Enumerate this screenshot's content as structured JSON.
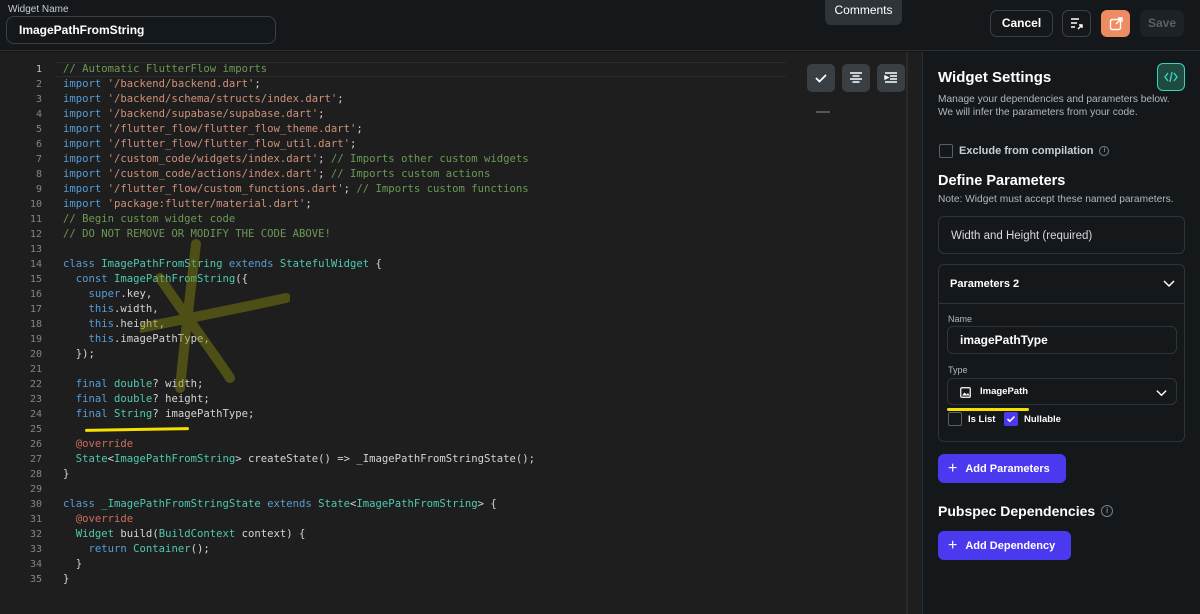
{
  "header": {
    "widget_name_label": "Widget Name",
    "widget_name_value": "ImagePathFromString",
    "comments_tooltip": "Comments",
    "cancel_label": "Cancel",
    "save_label": "Save",
    "accent_color": "#ee8b60"
  },
  "editor": {
    "active_line": 1,
    "line_numbers": [
      "1",
      "2",
      "3",
      "4",
      "5",
      "6",
      "7",
      "8",
      "9",
      "10",
      "11",
      "12",
      "13",
      "14",
      "15",
      "16",
      "17",
      "18",
      "19",
      "20",
      "21",
      "22",
      "23",
      "24",
      "25",
      "26",
      "27",
      "28",
      "29",
      "30",
      "31",
      "32",
      "33",
      "34",
      "35"
    ],
    "lines": [
      [
        [
          "c-cm",
          "// Automatic FlutterFlow imports"
        ]
      ],
      [
        [
          "c-kw",
          "import "
        ],
        [
          "c-st",
          "'/backend/backend.dart'"
        ],
        [
          "c-pu",
          ";"
        ]
      ],
      [
        [
          "c-kw",
          "import "
        ],
        [
          "c-st",
          "'/backend/schema/structs/index.dart'"
        ],
        [
          "c-pu",
          ";"
        ]
      ],
      [
        [
          "c-kw",
          "import "
        ],
        [
          "c-st",
          "'/backend/supabase/supabase.dart'"
        ],
        [
          "c-pu",
          ";"
        ]
      ],
      [
        [
          "c-kw",
          "import "
        ],
        [
          "c-st",
          "'/flutter_flow/flutter_flow_theme.dart'"
        ],
        [
          "c-pu",
          ";"
        ]
      ],
      [
        [
          "c-kw",
          "import "
        ],
        [
          "c-st",
          "'/flutter_flow/flutter_flow_util.dart'"
        ],
        [
          "c-pu",
          ";"
        ]
      ],
      [
        [
          "c-kw",
          "import "
        ],
        [
          "c-st",
          "'/custom_code/widgets/index.dart'"
        ],
        [
          "c-pu",
          "; "
        ],
        [
          "c-cm",
          "// Imports other custom widgets"
        ]
      ],
      [
        [
          "c-kw",
          "import "
        ],
        [
          "c-st",
          "'/custom_code/actions/index.dart'"
        ],
        [
          "c-pu",
          "; "
        ],
        [
          "c-cm",
          "// Imports custom actions"
        ]
      ],
      [
        [
          "c-kw",
          "import "
        ],
        [
          "c-st",
          "'/flutter_flow/custom_functions.dart'"
        ],
        [
          "c-pu",
          "; "
        ],
        [
          "c-cm",
          "// Imports custom functions"
        ]
      ],
      [
        [
          "c-kw",
          "import "
        ],
        [
          "c-st",
          "'package:flutter/material.dart'"
        ],
        [
          "c-pu",
          ";"
        ]
      ],
      [
        [
          "c-cm",
          "// Begin custom widget code"
        ]
      ],
      [
        [
          "c-cm",
          "// DO NOT REMOVE OR MODIFY THE CODE ABOVE!"
        ]
      ],
      [],
      [
        [
          "c-kw",
          "class "
        ],
        [
          "c-ty",
          "ImagePathFromString"
        ],
        [
          "c-kw",
          " extends "
        ],
        [
          "c-ty",
          "StatefulWidget"
        ],
        [
          "c-pu",
          " {"
        ]
      ],
      [
        [
          "c-pu",
          "  "
        ],
        [
          "c-kw",
          "const "
        ],
        [
          "c-ty",
          "ImagePathFromString"
        ],
        [
          "c-pu",
          "({"
        ]
      ],
      [
        [
          "c-pu",
          "    "
        ],
        [
          "c-kw",
          "super"
        ],
        [
          "c-pu",
          ".key,"
        ]
      ],
      [
        [
          "c-pu",
          "    "
        ],
        [
          "c-kw",
          "this"
        ],
        [
          "c-pu",
          ".width,"
        ]
      ],
      [
        [
          "c-pu",
          "    "
        ],
        [
          "c-kw",
          "this"
        ],
        [
          "c-pu",
          ".height,"
        ]
      ],
      [
        [
          "c-pu",
          "    "
        ],
        [
          "c-kw",
          "this"
        ],
        [
          "c-pu",
          ".imagePathType,"
        ]
      ],
      [
        [
          "c-pu",
          "  });"
        ]
      ],
      [],
      [
        [
          "c-pu",
          "  "
        ],
        [
          "c-kw",
          "final "
        ],
        [
          "c-ty",
          "double"
        ],
        [
          "c-pu",
          "? width;"
        ]
      ],
      [
        [
          "c-pu",
          "  "
        ],
        [
          "c-kw",
          "final "
        ],
        [
          "c-ty",
          "double"
        ],
        [
          "c-pu",
          "? height;"
        ]
      ],
      [
        [
          "c-pu",
          "  "
        ],
        [
          "c-kw",
          "final "
        ],
        [
          "c-ty",
          "String"
        ],
        [
          "c-pu",
          "? imagePathType;"
        ]
      ],
      [],
      [
        [
          "c-pu",
          "  "
        ],
        [
          "c-an",
          "@override"
        ]
      ],
      [
        [
          "c-pu",
          "  "
        ],
        [
          "c-ty",
          "State"
        ],
        [
          "c-pu",
          "<"
        ],
        [
          "c-ty",
          "ImagePathFromString"
        ],
        [
          "c-pu",
          "> createState() => _ImagePathFromStringState();"
        ]
      ],
      [
        [
          "c-pu",
          "}"
        ]
      ],
      [],
      [
        [
          "c-kw",
          "class "
        ],
        [
          "c-ty",
          "_ImagePathFromStringState"
        ],
        [
          "c-kw",
          " extends "
        ],
        [
          "c-ty",
          "State"
        ],
        [
          "c-pu",
          "<"
        ],
        [
          "c-ty",
          "ImagePathFromString"
        ],
        [
          "c-pu",
          "> {"
        ]
      ],
      [
        [
          "c-pu",
          "  "
        ],
        [
          "c-an",
          "@override"
        ]
      ],
      [
        [
          "c-pu",
          "  "
        ],
        [
          "c-ty",
          "Widget"
        ],
        [
          "c-pu",
          " build("
        ],
        [
          "c-ty",
          "BuildContext"
        ],
        [
          "c-pu",
          " context) {"
        ]
      ],
      [
        [
          "c-pu",
          "    "
        ],
        [
          "c-kw",
          "return "
        ],
        [
          "c-ty",
          "Container"
        ],
        [
          "c-pu",
          "();"
        ]
      ],
      [
        [
          "c-pu",
          "  }"
        ]
      ],
      [
        [
          "c-pu",
          "}"
        ]
      ]
    ]
  },
  "panel": {
    "title": "Widget Settings",
    "description": "Manage your dependencies and parameters below.\nWe will infer the parameters from your code.",
    "exclude_label": "Exclude from compilation",
    "define_title": "Define Parameters",
    "define_note": "Note: Widget must accept these named parameters.",
    "width_height": "Width and Height (required)",
    "param_card_title": "Parameters 2",
    "name_label": "Name",
    "name_value": "imagePathType",
    "type_label": "Type",
    "type_value": "ImagePath",
    "is_list_label": "Is List",
    "nullable_label": "Nullable",
    "add_parameters_label": "Add Parameters",
    "pubspec_title": "Pubspec Dependencies",
    "add_dependency_label": "Add Dependency",
    "primary_color": "#4b39ef",
    "highlight_color": "#f5e000"
  }
}
